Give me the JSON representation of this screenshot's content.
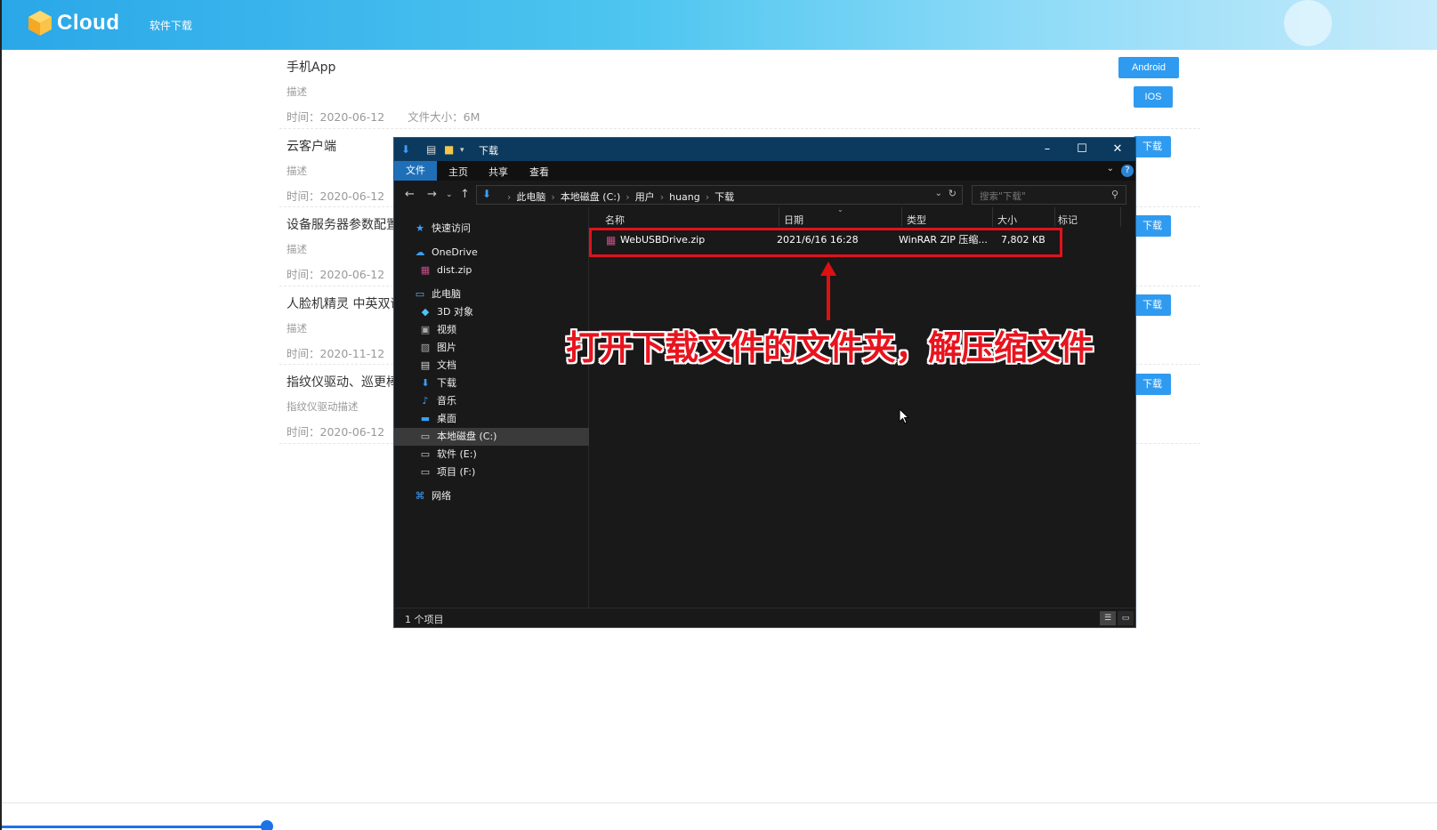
{
  "header": {
    "logo_text": "Cloud",
    "nav_link": "软件下载"
  },
  "items": [
    {
      "title": "手机App",
      "desc": "描述",
      "time": "时间：2020-06-12",
      "size": "文件大小：6M",
      "buttons": [
        "Android",
        "IOS"
      ]
    },
    {
      "title": "云客户端",
      "desc": "描述",
      "time": "时间：2020-06-12",
      "buttons": [
        "下载"
      ]
    },
    {
      "title": "设备服务器参数配置",
      "desc": "描述",
      "time": "时间：2020-06-12",
      "buttons": [
        "下载"
      ]
    },
    {
      "title": "人脸机精灵 中英双语",
      "desc": "描述",
      "time": "时间：2020-11-12",
      "buttons": [
        "下载"
      ]
    },
    {
      "title": "指纹仪驱动、巡更棒",
      "desc": "指纹仪驱动描述",
      "time": "时间：2020-06-12",
      "buttons": [
        "下载"
      ]
    }
  ],
  "explorer": {
    "title": "下载",
    "ribbon_tabs": [
      "文件",
      "主页",
      "共享",
      "查看"
    ],
    "breadcrumbs": [
      "此电脑",
      "本地磁盘 (C:)",
      "用户",
      "huang",
      "下载"
    ],
    "search_placeholder": "搜索\"下载\"",
    "nav": [
      {
        "label": "快速访问",
        "icon": "star-icon"
      },
      {
        "label": "OneDrive",
        "icon": "cloud-icon"
      },
      {
        "label": "dist.zip",
        "icon": "archive-icon"
      },
      {
        "label": "此电脑",
        "icon": "computer-icon"
      },
      {
        "label": "3D 对象",
        "icon": "cube-icon"
      },
      {
        "label": "视频",
        "icon": "video-icon"
      },
      {
        "label": "图片",
        "icon": "image-icon"
      },
      {
        "label": "文档",
        "icon": "document-icon"
      },
      {
        "label": "下载",
        "icon": "download-icon"
      },
      {
        "label": "音乐",
        "icon": "music-icon"
      },
      {
        "label": "桌面",
        "icon": "desktop-icon"
      },
      {
        "label": "本地磁盘 (C:)",
        "icon": "drive-icon",
        "selected": true
      },
      {
        "label": "软件 (E:)",
        "icon": "drive-icon"
      },
      {
        "label": "项目 (F:)",
        "icon": "drive-icon"
      },
      {
        "label": "网络",
        "icon": "network-icon"
      }
    ],
    "columns": [
      "名称",
      "日期",
      "类型",
      "大小",
      "标记"
    ],
    "files": [
      {
        "name": "WebUSBDrive.zip",
        "date": "2021/6/16 16:28",
        "type": "WinRAR ZIP 压缩...",
        "size": "7,802 KB"
      }
    ],
    "status": "1 个项目"
  },
  "annotation": "打开下载文件的文件夹，解压缩文件",
  "colors": {
    "accent": "#2f9bf0",
    "highlight": "#e0121d"
  }
}
